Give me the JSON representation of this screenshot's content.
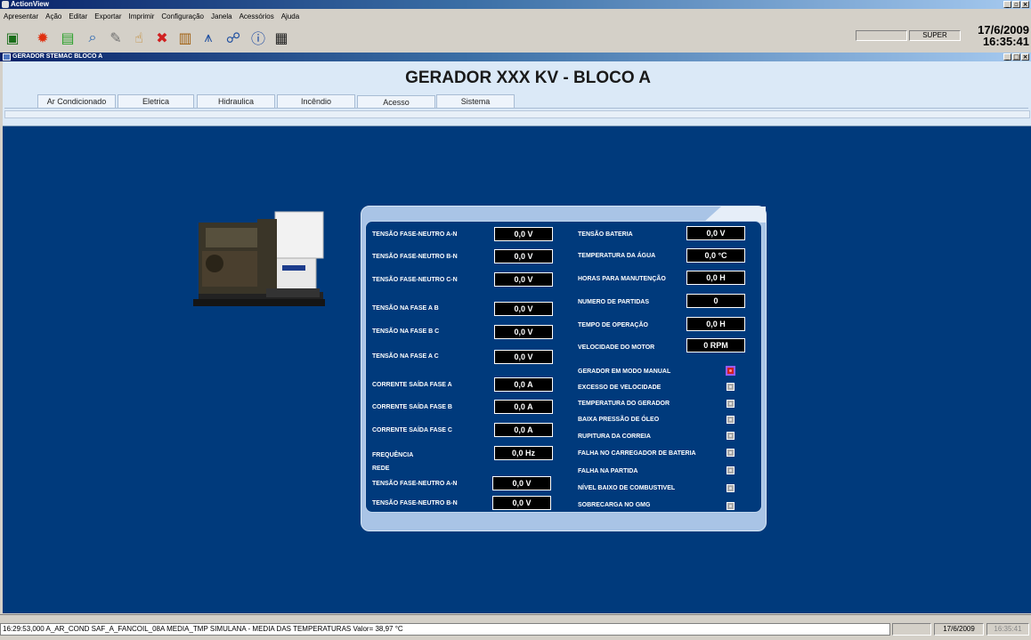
{
  "app": {
    "title": "ActionView"
  },
  "menu": [
    "Apresentar",
    "Ação",
    "Editar",
    "Exportar",
    "Imprimir",
    "Configuração",
    "Janela",
    "Acessórios",
    "Ajuda"
  ],
  "toolbar": {
    "icons": [
      "monitor-icon",
      "alarm-light-icon",
      "document-icon",
      "search-icon",
      "tools-icon",
      "thumbs-up-icon",
      "cancel-icon",
      "bar-chart-icon",
      "trend-chart-icon",
      "network-icon",
      "info-icon",
      "report-icon"
    ],
    "user_blank": "",
    "user": "SUPER",
    "date": "17/6/2009",
    "time": "16:35:41"
  },
  "window": {
    "title": "GERADOR STEMAC BLOCO A"
  },
  "page": {
    "title": "GERADOR XXX KV - BLOCO A"
  },
  "tabs": [
    "Ar Condicionado",
    "Eletrica",
    "Hidraulica",
    "Incêndio",
    "Acesso",
    "Sistema"
  ],
  "left_panel": [
    {
      "label": "TENSÃO FASE-NEUTRO A-N",
      "value": "0,0 V"
    },
    {
      "label": "TENSÃO FASE-NEUTRO B-N",
      "value": "0,0 V"
    },
    {
      "label": "TENSÃO FASE-NEUTRO C-N",
      "value": "0,0 V"
    },
    {
      "label": "TENSÃO NA FASE A B",
      "value": "0,0 V"
    },
    {
      "label": "TENSÃO NA FASE B C",
      "value": "0,0 V"
    },
    {
      "label": "TENSÃO NA FASE A C",
      "value": "0,0 V"
    },
    {
      "label": "CORRENTE SAÍDA FASE A",
      "value": "0,0 A"
    },
    {
      "label": "CORRENTE SAÍDA FASE B",
      "value": "0,0 A"
    },
    {
      "label": "CORRENTE SAÍDA FASE C",
      "value": "0,0 A"
    },
    {
      "label": "FREQUÊNCIA",
      "value": "0,0 Hz"
    }
  ],
  "rede": {
    "heading": "REDE",
    "items": [
      {
        "label": "TENSÃO FASE-NEUTRO A-N",
        "value": "0,0 V"
      },
      {
        "label": "TENSÃO FASE-NEUTRO B-N",
        "value": "0,0 V"
      }
    ]
  },
  "right_panel": [
    {
      "label": "TENSÃO BATERIA",
      "value": "0,0 V"
    },
    {
      "label": "TEMPERATURA DA ÁGUA",
      "value": "0,0 °C"
    },
    {
      "label": "HORAS PARA MANUTENÇÃO",
      "value": "0,0 H"
    },
    {
      "label": "NUMERO DE PARTIDAS",
      "value": "0"
    },
    {
      "label": "TEMPO DE OPERAÇÃO",
      "value": "0,0 H"
    },
    {
      "label": "VELOCIDADE DO MOTOR",
      "value": "0 RPM"
    }
  ],
  "alarms": [
    {
      "label": "GERADOR EM MODO MANUAL",
      "state": "active"
    },
    {
      "label": "EXCESSO DE VELOCIDADE",
      "state": "normal"
    },
    {
      "label": "TEMPERATURA DO GERADOR",
      "state": "normal"
    },
    {
      "label": "BAIXA PRESSÃO DE ÓLEO",
      "state": "normal"
    },
    {
      "label": "RUPITURA DA CORREIA",
      "state": "normal"
    },
    {
      "label": "FALHA NO CARREGADOR DE BATERIA",
      "state": "normal"
    },
    {
      "label": "FALHA NA PARTIDA",
      "state": "normal"
    },
    {
      "label": "NÍVEL BAIXO DE COMBUSTIVEL",
      "state": "normal"
    },
    {
      "label": "SOBRECARGA NO GMG",
      "state": "normal"
    }
  ],
  "statusbar": {
    "message": "16:29:53,000  A_AR_COND SAF_A_FANCOIL_08A MEDIA_TMP SIMULANA  - MEDIA DAS TEMPERATURAS Valor= 38,97 °C",
    "blank": "",
    "date": "17/6/2009",
    "time": "16:35:41"
  },
  "colors": {
    "background": "#003a7c",
    "panel": "#a9c4e6",
    "alarm_active": "#d42020"
  }
}
